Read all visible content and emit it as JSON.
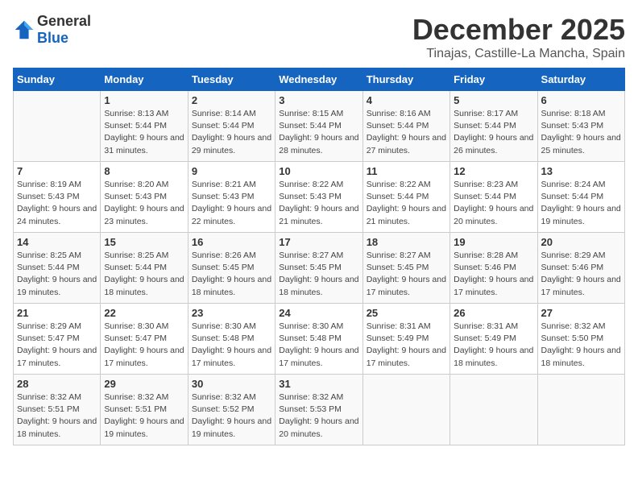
{
  "logo": {
    "general": "General",
    "blue": "Blue"
  },
  "title": "December 2025",
  "subtitle": "Tinajas, Castille-La Mancha, Spain",
  "days_of_week": [
    "Sunday",
    "Monday",
    "Tuesday",
    "Wednesday",
    "Thursday",
    "Friday",
    "Saturday"
  ],
  "weeks": [
    [
      {
        "day": "",
        "sunrise": "",
        "sunset": "",
        "daylight": ""
      },
      {
        "day": "1",
        "sunrise": "Sunrise: 8:13 AM",
        "sunset": "Sunset: 5:44 PM",
        "daylight": "Daylight: 9 hours and 31 minutes."
      },
      {
        "day": "2",
        "sunrise": "Sunrise: 8:14 AM",
        "sunset": "Sunset: 5:44 PM",
        "daylight": "Daylight: 9 hours and 29 minutes."
      },
      {
        "day": "3",
        "sunrise": "Sunrise: 8:15 AM",
        "sunset": "Sunset: 5:44 PM",
        "daylight": "Daylight: 9 hours and 28 minutes."
      },
      {
        "day": "4",
        "sunrise": "Sunrise: 8:16 AM",
        "sunset": "Sunset: 5:44 PM",
        "daylight": "Daylight: 9 hours and 27 minutes."
      },
      {
        "day": "5",
        "sunrise": "Sunrise: 8:17 AM",
        "sunset": "Sunset: 5:44 PM",
        "daylight": "Daylight: 9 hours and 26 minutes."
      },
      {
        "day": "6",
        "sunrise": "Sunrise: 8:18 AM",
        "sunset": "Sunset: 5:43 PM",
        "daylight": "Daylight: 9 hours and 25 minutes."
      }
    ],
    [
      {
        "day": "7",
        "sunrise": "Sunrise: 8:19 AM",
        "sunset": "Sunset: 5:43 PM",
        "daylight": "Daylight: 9 hours and 24 minutes."
      },
      {
        "day": "8",
        "sunrise": "Sunrise: 8:20 AM",
        "sunset": "Sunset: 5:43 PM",
        "daylight": "Daylight: 9 hours and 23 minutes."
      },
      {
        "day": "9",
        "sunrise": "Sunrise: 8:21 AM",
        "sunset": "Sunset: 5:43 PM",
        "daylight": "Daylight: 9 hours and 22 minutes."
      },
      {
        "day": "10",
        "sunrise": "Sunrise: 8:22 AM",
        "sunset": "Sunset: 5:43 PM",
        "daylight": "Daylight: 9 hours and 21 minutes."
      },
      {
        "day": "11",
        "sunrise": "Sunrise: 8:22 AM",
        "sunset": "Sunset: 5:44 PM",
        "daylight": "Daylight: 9 hours and 21 minutes."
      },
      {
        "day": "12",
        "sunrise": "Sunrise: 8:23 AM",
        "sunset": "Sunset: 5:44 PM",
        "daylight": "Daylight: 9 hours and 20 minutes."
      },
      {
        "day": "13",
        "sunrise": "Sunrise: 8:24 AM",
        "sunset": "Sunset: 5:44 PM",
        "daylight": "Daylight: 9 hours and 19 minutes."
      }
    ],
    [
      {
        "day": "14",
        "sunrise": "Sunrise: 8:25 AM",
        "sunset": "Sunset: 5:44 PM",
        "daylight": "Daylight: 9 hours and 19 minutes."
      },
      {
        "day": "15",
        "sunrise": "Sunrise: 8:25 AM",
        "sunset": "Sunset: 5:44 PM",
        "daylight": "Daylight: 9 hours and 18 minutes."
      },
      {
        "day": "16",
        "sunrise": "Sunrise: 8:26 AM",
        "sunset": "Sunset: 5:45 PM",
        "daylight": "Daylight: 9 hours and 18 minutes."
      },
      {
        "day": "17",
        "sunrise": "Sunrise: 8:27 AM",
        "sunset": "Sunset: 5:45 PM",
        "daylight": "Daylight: 9 hours and 18 minutes."
      },
      {
        "day": "18",
        "sunrise": "Sunrise: 8:27 AM",
        "sunset": "Sunset: 5:45 PM",
        "daylight": "Daylight: 9 hours and 17 minutes."
      },
      {
        "day": "19",
        "sunrise": "Sunrise: 8:28 AM",
        "sunset": "Sunset: 5:46 PM",
        "daylight": "Daylight: 9 hours and 17 minutes."
      },
      {
        "day": "20",
        "sunrise": "Sunrise: 8:29 AM",
        "sunset": "Sunset: 5:46 PM",
        "daylight": "Daylight: 9 hours and 17 minutes."
      }
    ],
    [
      {
        "day": "21",
        "sunrise": "Sunrise: 8:29 AM",
        "sunset": "Sunset: 5:47 PM",
        "daylight": "Daylight: 9 hours and 17 minutes."
      },
      {
        "day": "22",
        "sunrise": "Sunrise: 8:30 AM",
        "sunset": "Sunset: 5:47 PM",
        "daylight": "Daylight: 9 hours and 17 minutes."
      },
      {
        "day": "23",
        "sunrise": "Sunrise: 8:30 AM",
        "sunset": "Sunset: 5:48 PM",
        "daylight": "Daylight: 9 hours and 17 minutes."
      },
      {
        "day": "24",
        "sunrise": "Sunrise: 8:30 AM",
        "sunset": "Sunset: 5:48 PM",
        "daylight": "Daylight: 9 hours and 17 minutes."
      },
      {
        "day": "25",
        "sunrise": "Sunrise: 8:31 AM",
        "sunset": "Sunset: 5:49 PM",
        "daylight": "Daylight: 9 hours and 17 minutes."
      },
      {
        "day": "26",
        "sunrise": "Sunrise: 8:31 AM",
        "sunset": "Sunset: 5:49 PM",
        "daylight": "Daylight: 9 hours and 18 minutes."
      },
      {
        "day": "27",
        "sunrise": "Sunrise: 8:32 AM",
        "sunset": "Sunset: 5:50 PM",
        "daylight": "Daylight: 9 hours and 18 minutes."
      }
    ],
    [
      {
        "day": "28",
        "sunrise": "Sunrise: 8:32 AM",
        "sunset": "Sunset: 5:51 PM",
        "daylight": "Daylight: 9 hours and 18 minutes."
      },
      {
        "day": "29",
        "sunrise": "Sunrise: 8:32 AM",
        "sunset": "Sunset: 5:51 PM",
        "daylight": "Daylight: 9 hours and 19 minutes."
      },
      {
        "day": "30",
        "sunrise": "Sunrise: 8:32 AM",
        "sunset": "Sunset: 5:52 PM",
        "daylight": "Daylight: 9 hours and 19 minutes."
      },
      {
        "day": "31",
        "sunrise": "Sunrise: 8:32 AM",
        "sunset": "Sunset: 5:53 PM",
        "daylight": "Daylight: 9 hours and 20 minutes."
      },
      {
        "day": "",
        "sunrise": "",
        "sunset": "",
        "daylight": ""
      },
      {
        "day": "",
        "sunrise": "",
        "sunset": "",
        "daylight": ""
      },
      {
        "day": "",
        "sunrise": "",
        "sunset": "",
        "daylight": ""
      }
    ]
  ]
}
